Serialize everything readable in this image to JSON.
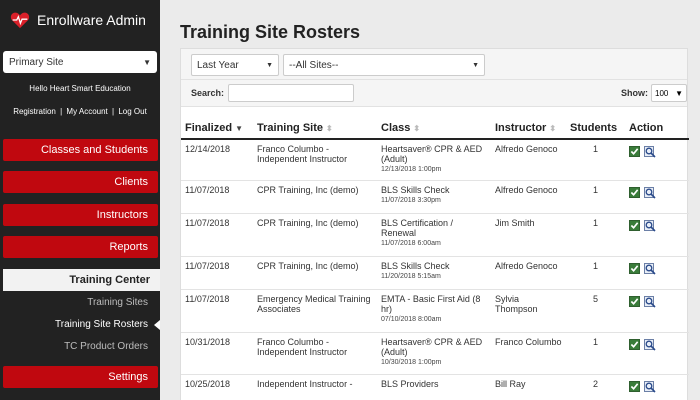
{
  "app": {
    "brand": "Enrollware Admin"
  },
  "sidebar": {
    "site_select": "Primary Site",
    "greeting": "Hello Heart Smart Education",
    "links": {
      "registration": "Registration",
      "my_account": "My Account",
      "log_out": "Log Out",
      "separator": "|"
    },
    "nav": {
      "classes": "Classes and Students",
      "clients": "Clients",
      "instructors": "Instructors",
      "reports": "Reports",
      "training_center": "Training Center",
      "settings": "Settings"
    },
    "sub": {
      "training_sites": "Training Sites",
      "training_site_rosters": "Training Site Rosters",
      "tc_product_orders": "TC Product Orders"
    }
  },
  "main": {
    "title": "Training Site Rosters",
    "filters": {
      "period": "Last Year",
      "sites": "--All Sites--"
    },
    "search_label": "Search:",
    "show_label": "Show:",
    "show_value": "100",
    "columns": [
      "Finalized",
      "Training Site",
      "Class",
      "Instructor",
      "Students",
      "Action"
    ],
    "rows": [
      {
        "finalized": "12/14/2018",
        "site": "Franco Columbo - Independent Instructor",
        "class": "Heartsaver® CPR & AED (Adult)",
        "class_date": "12/13/2018 1:00pm",
        "instructor": "Alfredo Genoco",
        "students": "1"
      },
      {
        "finalized": "11/07/2018",
        "site": "CPR Training, Inc (demo)",
        "class": "BLS Skills Check",
        "class_date": "11/07/2018 3:30pm",
        "instructor": "Alfredo Genoco",
        "students": "1"
      },
      {
        "finalized": "11/07/2018",
        "site": "CPR Training, Inc (demo)",
        "class": "BLS Certification / Renewal",
        "class_date": "11/07/2018 6:00am",
        "instructor": "Jim Smith",
        "students": "1"
      },
      {
        "finalized": "11/07/2018",
        "site": "CPR Training, Inc (demo)",
        "class": "BLS Skills Check",
        "class_date": "11/20/2018 5:15am",
        "instructor": "Alfredo Genoco",
        "students": "1"
      },
      {
        "finalized": "11/07/2018",
        "site": "Emergency Medical Training Associates",
        "class": "EMTA - Basic First Aid (8 hr)",
        "class_date": "07/10/2018 8:00am",
        "instructor": "Sylvia Thompson",
        "students": "5"
      },
      {
        "finalized": "10/31/2018",
        "site": "Franco Columbo - Independent Instructor",
        "class": "Heartsaver® CPR & AED (Adult)",
        "class_date": "10/30/2018 1:00pm",
        "instructor": "Franco Columbo",
        "students": "1"
      },
      {
        "finalized": "10/25/2018",
        "site": "Independent Instructor -",
        "class": "BLS Providers",
        "class_date": "",
        "instructor": "Bill Ray",
        "students": "2"
      }
    ]
  },
  "colors": {
    "sidebar_bg": "#222222",
    "nav_red": "#c0080f",
    "page_bg": "#ebebeb"
  },
  "icons": {
    "brand": "heart-pulse-icon",
    "approve": "checkmark-icon",
    "view": "magnify-icon"
  }
}
